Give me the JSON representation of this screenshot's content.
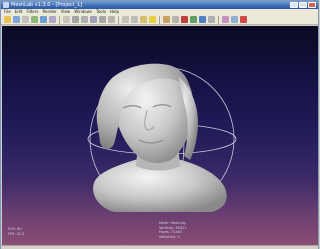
{
  "window": {
    "title": "MeshLab v1.3.0 - [Project_1]"
  },
  "menu": {
    "items": [
      "File",
      "Edit",
      "Filters",
      "Render",
      "View",
      "Windows",
      "Tools",
      "Help"
    ]
  },
  "toolbar": {
    "buttons": [
      {
        "name": "open-project-icon",
        "color": "#e6c258"
      },
      {
        "name": "save-project-icon",
        "color": "#7fa6d6"
      },
      {
        "name": "close-project-icon",
        "color": "#c0c0c0"
      },
      {
        "name": "import-mesh-icon",
        "color": "#8fb87c"
      },
      {
        "name": "export-mesh-icon",
        "color": "#6f9fd2"
      },
      {
        "name": "snapshot-icon",
        "color": "#b0a8c8"
      },
      {
        "name": "show-layers-icon",
        "color": "#c8c4bc"
      },
      {
        "name": "bounding-box-icon",
        "color": "#a4a4a4"
      },
      {
        "name": "points-icon",
        "color": "#b0b0b0"
      },
      {
        "name": "wireframe-icon",
        "color": "#a0a0b8"
      },
      {
        "name": "hidden-lines-icon",
        "color": "#a8a8a8"
      },
      {
        "name": "flat-lines-icon",
        "color": "#b8b4ac"
      },
      {
        "name": "flat-icon",
        "color": "#c4c0b8"
      },
      {
        "name": "smooth-icon",
        "color": "#bcbcbc"
      },
      {
        "name": "texture-icon",
        "color": "#d4c070"
      },
      {
        "name": "light-icon",
        "color": "#e8d040"
      },
      {
        "name": "face-culling-icon",
        "color": "#c8a060"
      },
      {
        "name": "color-mode-icon",
        "color": "#b8b4ac"
      },
      {
        "name": "select-faces-icon",
        "color": "#c04040"
      },
      {
        "name": "select-vertices-icon",
        "color": "#60a060"
      },
      {
        "name": "align-icon",
        "color": "#5080c8"
      },
      {
        "name": "measure-icon",
        "color": "#b0b0b0"
      },
      {
        "name": "paint-icon",
        "color": "#c890c0"
      },
      {
        "name": "manipulator-icon",
        "color": "#90b0d0"
      },
      {
        "name": "delete-icon",
        "color": "#d04848"
      }
    ]
  },
  "viewport": {
    "info_left": [
      "FOV: 60",
      "FPS:  22.5"
    ],
    "info_right": [
      "Mesh: Head.ply",
      "Vertices: 36021",
      "Faces: 71467",
      "Selection: 0"
    ]
  }
}
